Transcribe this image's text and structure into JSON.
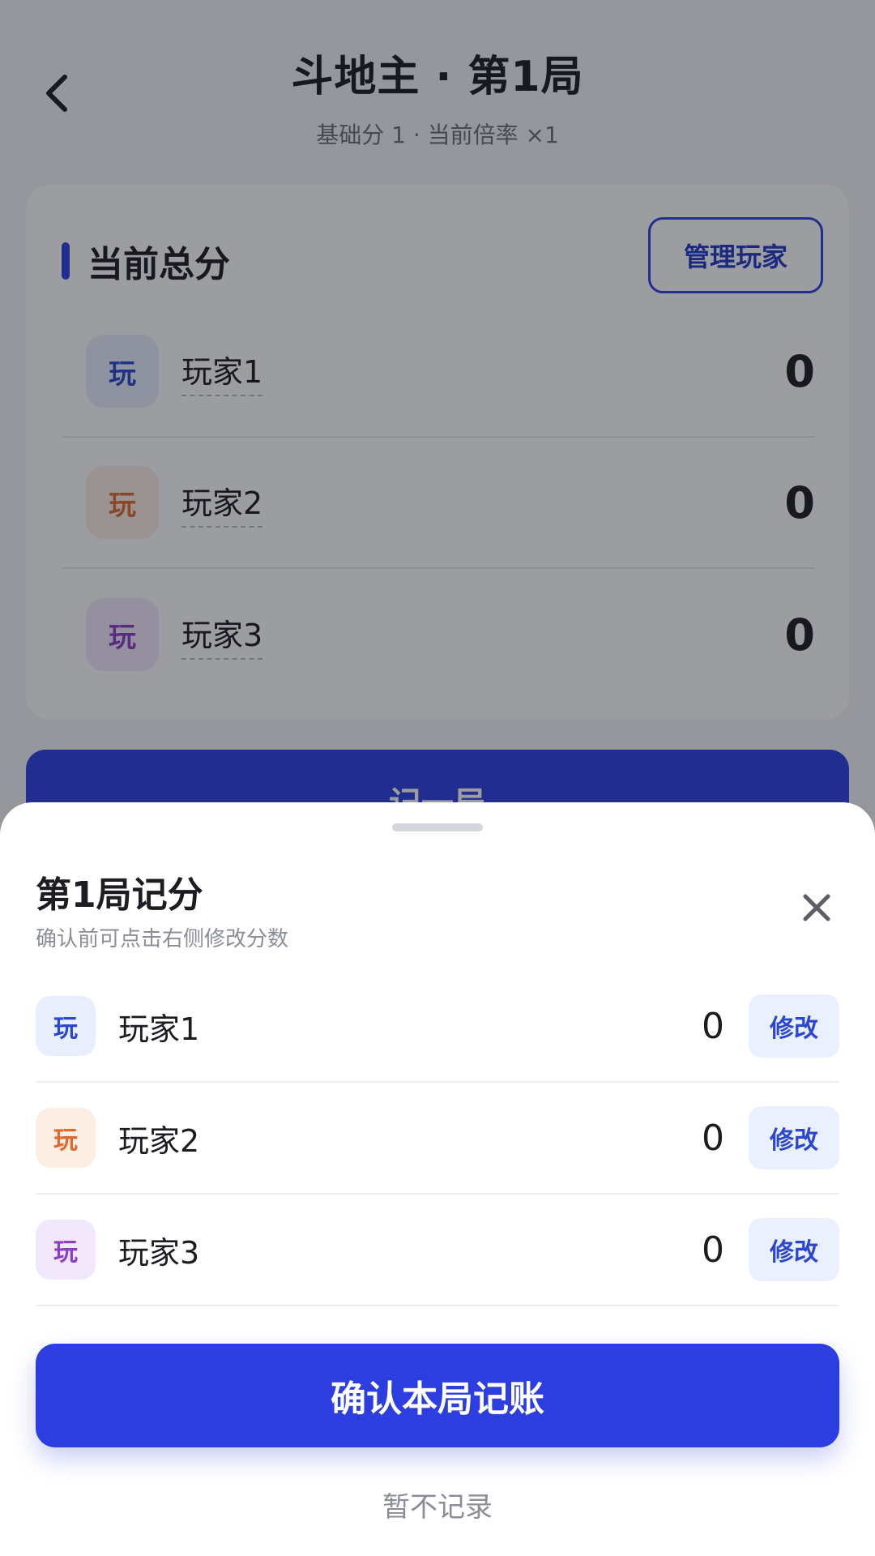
{
  "header": {
    "title": "斗地主 · 第1局",
    "subtitle": "基础分 1 · 当前倍率 ×1"
  },
  "score_card": {
    "title": "当前总分",
    "manage_label": "管理玩家",
    "players": [
      {
        "avatar": "玩",
        "name": "玩家1",
        "score": "0"
      },
      {
        "avatar": "玩",
        "name": "玩家2",
        "score": "0"
      },
      {
        "avatar": "玩",
        "name": "玩家3",
        "score": "0"
      }
    ]
  },
  "record_button_label": "记一局",
  "sheet": {
    "title": "第1局记分",
    "subtitle": "确认前可点击右侧修改分数",
    "rows": [
      {
        "avatar": "玩",
        "name": "玩家1",
        "score": "0",
        "edit_label": "修改"
      },
      {
        "avatar": "玩",
        "name": "玩家2",
        "score": "0",
        "edit_label": "修改"
      },
      {
        "avatar": "玩",
        "name": "玩家3",
        "score": "0",
        "edit_label": "修改"
      }
    ],
    "confirm_label": "确认本局记账",
    "skip_label": "暂不记录"
  },
  "icons": {
    "back": "chevron-left-icon",
    "close": "close-icon"
  },
  "colors": {
    "accent": "#2c3ee0",
    "player1_bg": "#e8eefc",
    "player1_fg": "#2c47cf",
    "player2_bg": "#fdeee4",
    "player2_fg": "#e06a2c",
    "player3_bg": "#f2e8fb",
    "player3_fg": "#8a3fc6"
  }
}
